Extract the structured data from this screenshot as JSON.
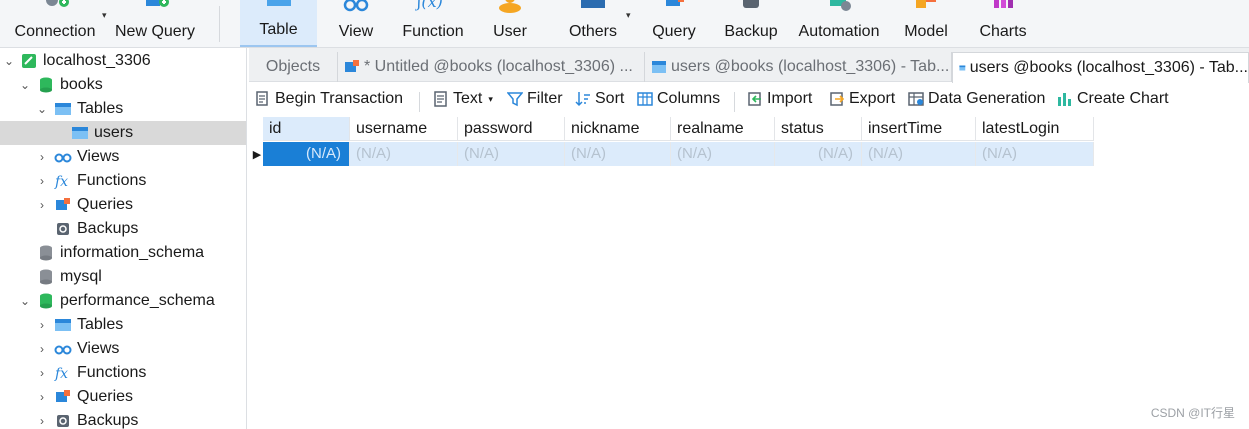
{
  "toolbar": {
    "buttons": [
      {
        "label": "Connection"
      },
      {
        "label": "New Query"
      },
      {
        "label": "Table"
      },
      {
        "label": "View"
      },
      {
        "label": "Function"
      },
      {
        "label": "User"
      },
      {
        "label": "Others"
      },
      {
        "label": "Query"
      },
      {
        "label": "Backup"
      },
      {
        "label": "Automation"
      },
      {
        "label": "Model"
      },
      {
        "label": "Charts"
      }
    ],
    "active": "Table"
  },
  "nav": {
    "items": [
      {
        "label": "localhost_3306",
        "icon": "connection-icon"
      },
      {
        "label": "books",
        "icon": "database-icon"
      },
      {
        "label": "Tables",
        "icon": "tables-icon"
      },
      {
        "label": "users",
        "icon": "table-icon"
      },
      {
        "label": "Views",
        "icon": "views-icon"
      },
      {
        "label": "Functions",
        "icon": "functions-icon"
      },
      {
        "label": "Queries",
        "icon": "queries-icon"
      },
      {
        "label": "Backups",
        "icon": "backups-icon"
      },
      {
        "label": "information_schema",
        "icon": "database-icon"
      },
      {
        "label": "mysql",
        "icon": "database-icon"
      },
      {
        "label": "performance_schema",
        "icon": "database-icon"
      },
      {
        "label": "Tables",
        "icon": "tables-icon"
      },
      {
        "label": "Views",
        "icon": "views-icon"
      },
      {
        "label": "Functions",
        "icon": "functions-icon"
      },
      {
        "label": "Queries",
        "icon": "queries-icon"
      },
      {
        "label": "Backups",
        "icon": "backups-icon"
      }
    ]
  },
  "tabs": [
    {
      "label": "Objects"
    },
    {
      "label": "* Untitled @books (localhost_3306) ..."
    },
    {
      "label": "users @books (localhost_3306) - Tab..."
    },
    {
      "label": "users @books (localhost_3306) - Tab..."
    }
  ],
  "subtoolbar": {
    "begin_transaction": "Begin Transaction",
    "text": "Text",
    "filter": "Filter",
    "sort": "Sort",
    "columns": "Columns",
    "import": "Import",
    "export": "Export",
    "data_generation": "Data Generation",
    "create_chart": "Create Chart"
  },
  "grid": {
    "columns": [
      "id",
      "username",
      "password",
      "nickname",
      "realname",
      "status",
      "insertTime",
      "latestLogin"
    ],
    "row": [
      "(N/A)",
      "(N/A)",
      "(N/A)",
      "(N/A)",
      "(N/A)",
      "(N/A)",
      "(N/A)",
      "(N/A)"
    ]
  },
  "watermark": "CSDN @IT行星",
  "colors": {
    "accent": "#1a7fd6",
    "selection": "#dcebfb",
    "database_green": "#2eb85c"
  }
}
